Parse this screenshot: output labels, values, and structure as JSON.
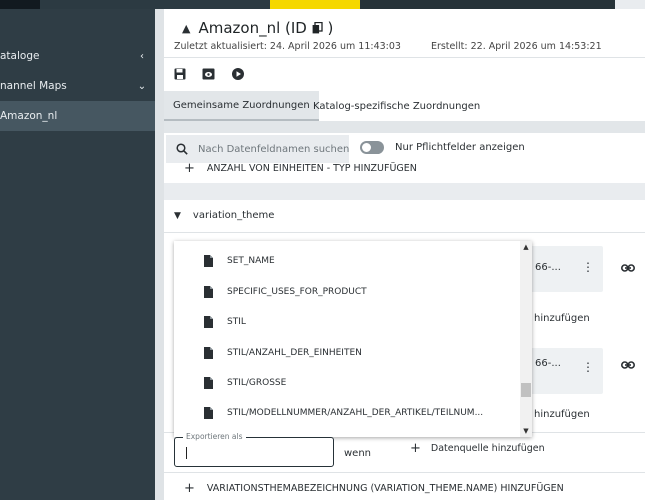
{
  "sidebar": {
    "items": [
      {
        "label": "ataloge",
        "chevron": "‹"
      },
      {
        "label": "nannel Maps",
        "chevron": "⌄"
      },
      {
        "label": "Amazon_nl",
        "chevron": ""
      }
    ]
  },
  "header": {
    "title": "Amazon_nl (ID",
    "title_end": ")",
    "updated": "Zuletzt aktualisiert: 24. April 2026 um 11:43:03",
    "created": "Erstellt: 22. April 2026 um 14:53:21"
  },
  "tabs": [
    {
      "label": "Gemeinsame Zuordnungen"
    },
    {
      "label": "Katalog-spezifische Zuordnungen"
    }
  ],
  "filter": {
    "search_placeholder": "Nach Datenfeldnamen suchen",
    "toggle_label": "Nur Pflichtfelder anzeigen"
  },
  "rows": {
    "add_count_type": "ANZAHL VON EINHEITEN - TYP HINZUFÜGEN",
    "section": "variation_theme",
    "card1_text": "66-...",
    "card2_text": "66-...",
    "hinzufuegen": "hinzufügen",
    "add_theme_name": "VARIATIONSTHEMABEZEICHNUNG (VARIATION_THEME.NAME) HINZUFÜGEN"
  },
  "dropdown": {
    "items": [
      "SET_NAME",
      "SPECIFIC_USES_FOR_PRODUCT",
      "STIL",
      "STIL/ANZAHL_DER_EINHEITEN",
      "STIL/GRÖSSE",
      "STIL/MODELLNUMMER/ANZAHL_DER_ARTIKEL/TEILNUM..."
    ]
  },
  "export": {
    "label": "Exportieren als",
    "value": "",
    "wenn": "wenn",
    "datasource_add": "Datenquelle hinzufügen"
  }
}
